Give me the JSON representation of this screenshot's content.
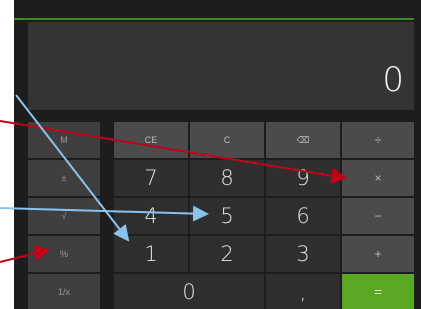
{
  "display": {
    "value": "0"
  },
  "keypad": {
    "memory": [
      "M",
      "±",
      "√",
      "%",
      "1/x"
    ],
    "row1": [
      "CE",
      "C",
      "⌫",
      "÷"
    ],
    "row2": [
      "7",
      "8",
      "9",
      "×"
    ],
    "row3": [
      "4",
      "5",
      "6",
      "−"
    ],
    "row4": [
      "1",
      "2",
      "3",
      "+"
    ],
    "row5": [
      "0",
      ",",
      "="
    ]
  },
  "colors": {
    "accent": "#59a723",
    "arrow_red": "#c40018",
    "arrow_blue": "#89c4ee"
  }
}
